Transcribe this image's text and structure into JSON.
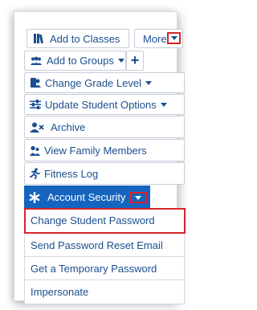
{
  "toolbar": {
    "add_to_classes": "Add to Classes",
    "more": "More",
    "add_to_groups": "Add to Groups",
    "add_plus": "+",
    "change_grade_level": "Change Grade Level",
    "update_student_options": "Update Student Options",
    "archive": "Archive",
    "view_family_members": "View Family Members",
    "fitness_log": "Fitness Log",
    "account_security": "Account Security"
  },
  "dropdown": {
    "items": [
      {
        "label": "Change Student Password",
        "highlighted": true
      },
      {
        "label": "Send Password Reset Email"
      },
      {
        "label": "Get a Temporary Password"
      },
      {
        "label": "Impersonate"
      }
    ]
  },
  "colors": {
    "accent": "#1565c0",
    "text": "#1b4f8f",
    "highlight_box": "#d9232a"
  },
  "icons": {
    "add_to_classes": "books-icon",
    "add_to_groups": "group-icon",
    "change_grade_level": "student-icon",
    "update_student_options": "sliders-icon",
    "archive": "user-remove-icon",
    "view_family_members": "family-icon",
    "fitness_log": "running-icon",
    "account_security": "asterisk-icon"
  }
}
